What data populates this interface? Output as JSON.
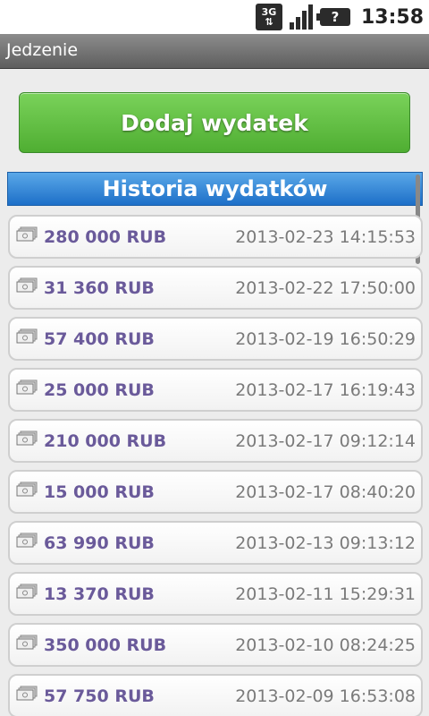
{
  "status_bar": {
    "network": "3G",
    "battery_symbol": "?",
    "time": "13:58"
  },
  "app": {
    "title": "Jedzenie"
  },
  "add_button": {
    "label": "Dodaj wydatek"
  },
  "history": {
    "header": "Historia wydatków",
    "items": [
      {
        "amount": "280 000 RUB",
        "date": "2013-02-23 14:15:53"
      },
      {
        "amount": "31 360 RUB",
        "date": "2013-02-22 17:50:00"
      },
      {
        "amount": "57 400 RUB",
        "date": "2013-02-19 16:50:29"
      },
      {
        "amount": "25 000 RUB",
        "date": "2013-02-17 16:19:43"
      },
      {
        "amount": "210 000 RUB",
        "date": "2013-02-17 09:12:14"
      },
      {
        "amount": "15 000 RUB",
        "date": "2013-02-17 08:40:20"
      },
      {
        "amount": "63 990 RUB",
        "date": "2013-02-13 09:13:12"
      },
      {
        "amount": "13 370 RUB",
        "date": "2013-02-11 15:29:31"
      },
      {
        "amount": "350 000 RUB",
        "date": "2013-02-10 08:24:25"
      },
      {
        "amount": "57 750 RUB",
        "date": "2013-02-09 16:53:08"
      }
    ]
  },
  "colors": {
    "accent_green": "#4fae32",
    "header_blue": "#1d6fc8",
    "amount_purple": "#6a5a9a"
  }
}
